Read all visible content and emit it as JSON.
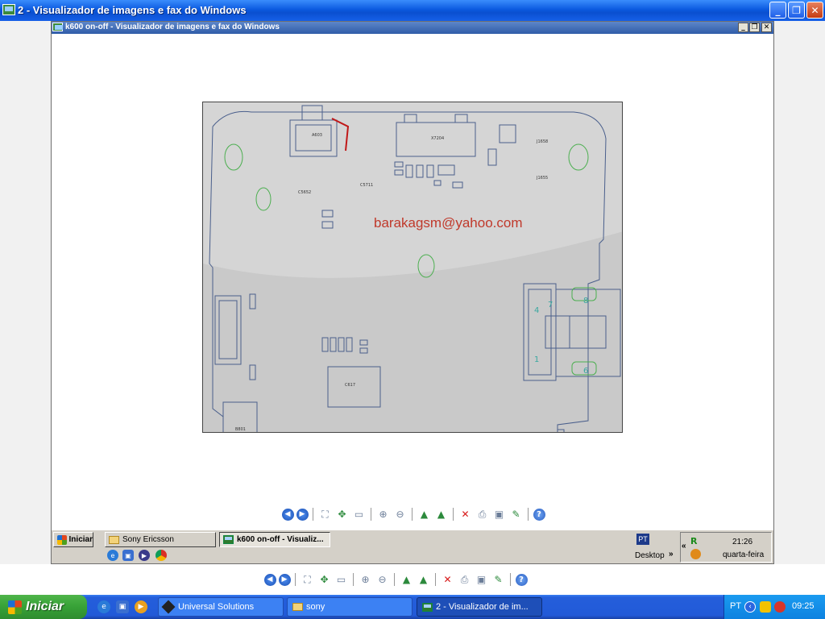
{
  "outer_window": {
    "title": "2 - Visualizador de imagens e fax do Windows",
    "minimize_symbol": "_",
    "restore_symbol": "❐",
    "close_symbol": "✕"
  },
  "inner_window": {
    "title": "k600 on-off - Visualizador de imagens e fax do Windows",
    "minimize_symbol": "_",
    "restore_symbol": "❐",
    "close_symbol": "✕"
  },
  "photo": {
    "watermark": "barakagsm@yahoo.com"
  },
  "toolbar_icons": [
    "previous-image-icon",
    "next-image-icon",
    "best-fit-icon",
    "actual-size-icon",
    "slideshow-icon",
    "zoom-in-icon",
    "zoom-out-icon",
    "rotate-clockwise-icon",
    "rotate-counterclockwise-icon",
    "delete-icon",
    "print-icon",
    "save-icon",
    "edit-icon",
    "help-icon"
  ],
  "inner_taskbar": {
    "start_label": "Iniciar",
    "tasks": [
      {
        "label": "Sony Ericsson"
      },
      {
        "label": "k600 on-off - Visualiz..."
      }
    ],
    "language": "PT",
    "desktop_label": "Desktop",
    "chevron": "»",
    "expand": "«",
    "clock": "21:26",
    "day": "quarta-feira"
  },
  "xp_taskbar": {
    "start_label": "Iniciar",
    "tasks": [
      {
        "label": "Universal Solutions"
      },
      {
        "label": "sony"
      },
      {
        "label": "2 - Visualizador de im..."
      }
    ],
    "language": "PT",
    "clock": "09:25"
  }
}
